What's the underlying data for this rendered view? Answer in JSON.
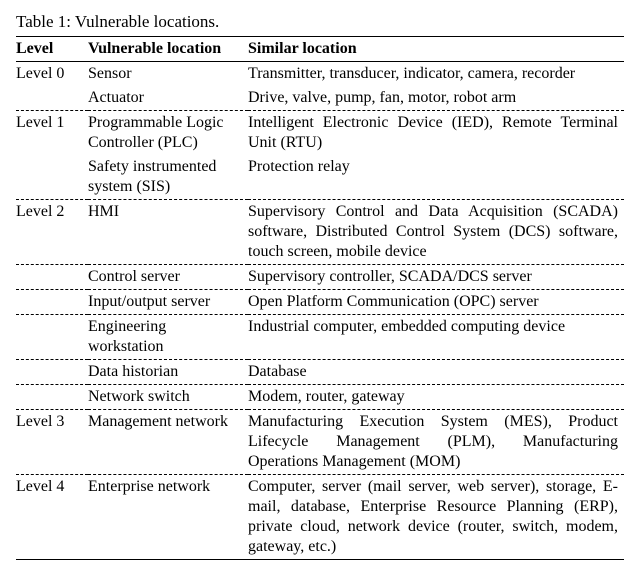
{
  "caption": "Table 1: Vulnerable locations.",
  "headers": {
    "level": "Level",
    "vulnerable": "Vulnerable location",
    "similar": "Similar location"
  },
  "rows": [
    {
      "level": "Level 0",
      "vulnerable": "Sensor",
      "similar": "Transmitter, transducer, indicator, camera, recorder",
      "rule": "none"
    },
    {
      "level": "",
      "vulnerable": "Actuator",
      "similar": "Drive, valve, pump, fan, motor, robot arm",
      "rule": "dash"
    },
    {
      "level": "Level 1",
      "vulnerable": "Programmable Logic Controller (PLC)",
      "similar": "Intelligent Electronic Device (IED), Remote Terminal Unit (RTU)",
      "rule": "none"
    },
    {
      "level": "",
      "vulnerable": "Safety instrumented system (SIS)",
      "similar": "Protection relay",
      "rule": "dash"
    },
    {
      "level": "Level 2",
      "vulnerable": "HMI",
      "similar": "Supervisory Control and Data Acquisition (SCADA) software, Distributed Control System (DCS) software, touch screen, mobile device",
      "rule": "dash"
    },
    {
      "level": "",
      "vulnerable": "Control server",
      "similar": "Supervisory controller, SCADA/DCS server",
      "rule": "dash"
    },
    {
      "level": "",
      "vulnerable": "Input/output server",
      "similar": "Open Platform Communication (OPC) server",
      "rule": "dash"
    },
    {
      "level": "",
      "vulnerable": "Engineering workstation",
      "similar": "Industrial computer, embedded computing device",
      "rule": "dash"
    },
    {
      "level": "",
      "vulnerable": "Data historian",
      "similar": "Database",
      "rule": "dash"
    },
    {
      "level": "",
      "vulnerable": "Network switch",
      "similar": "Modem, router, gateway",
      "rule": "dash"
    },
    {
      "level": "Level 3",
      "vulnerable": "Management network",
      "similar": "Manufacturing Execution System (MES), Product Lifecycle Management (PLM), Manufacturing Operations Management (MOM)",
      "rule": "dash"
    },
    {
      "level": "Level 4",
      "vulnerable": "Enterprise network",
      "similar": "Computer, server (mail server, web server), storage, E-mail, database, Enterprise Resource Planning (ERP), private cloud, network device (router, switch, modem, gateway, etc.)",
      "rule": "solid"
    }
  ],
  "chart_data": {
    "type": "table",
    "title": "Table 1: Vulnerable locations.",
    "columns": [
      "Level",
      "Vulnerable location",
      "Similar location"
    ],
    "rows": [
      [
        "Level 0",
        "Sensor",
        "Transmitter, transducer, indicator, camera, recorder"
      ],
      [
        "Level 0",
        "Actuator",
        "Drive, valve, pump, fan, motor, robot arm"
      ],
      [
        "Level 1",
        "Programmable Logic Controller (PLC)",
        "Intelligent Electronic Device (IED), Remote Terminal Unit (RTU)"
      ],
      [
        "Level 1",
        "Safety instrumented system (SIS)",
        "Protection relay"
      ],
      [
        "Level 2",
        "HMI",
        "Supervisory Control and Data Acquisition (SCADA) software, Distributed Control System (DCS) software, touch screen, mobile device"
      ],
      [
        "Level 2",
        "Control server",
        "Supervisory controller, SCADA/DCS server"
      ],
      [
        "Level 2",
        "Input/output server",
        "Open Platform Communication (OPC) server"
      ],
      [
        "Level 2",
        "Engineering workstation",
        "Industrial computer, embedded computing device"
      ],
      [
        "Level 2",
        "Data historian",
        "Database"
      ],
      [
        "Level 2",
        "Network switch",
        "Modem, router, gateway"
      ],
      [
        "Level 3",
        "Management network",
        "Manufacturing Execution System (MES), Product Lifecycle Management (PLM), Manufacturing Operations Management (MOM)"
      ],
      [
        "Level 4",
        "Enterprise network",
        "Computer, server (mail server, web server), storage, E-mail, database, Enterprise Resource Planning (ERP), private cloud, network device (router, switch, modem, gateway, etc.)"
      ]
    ]
  }
}
